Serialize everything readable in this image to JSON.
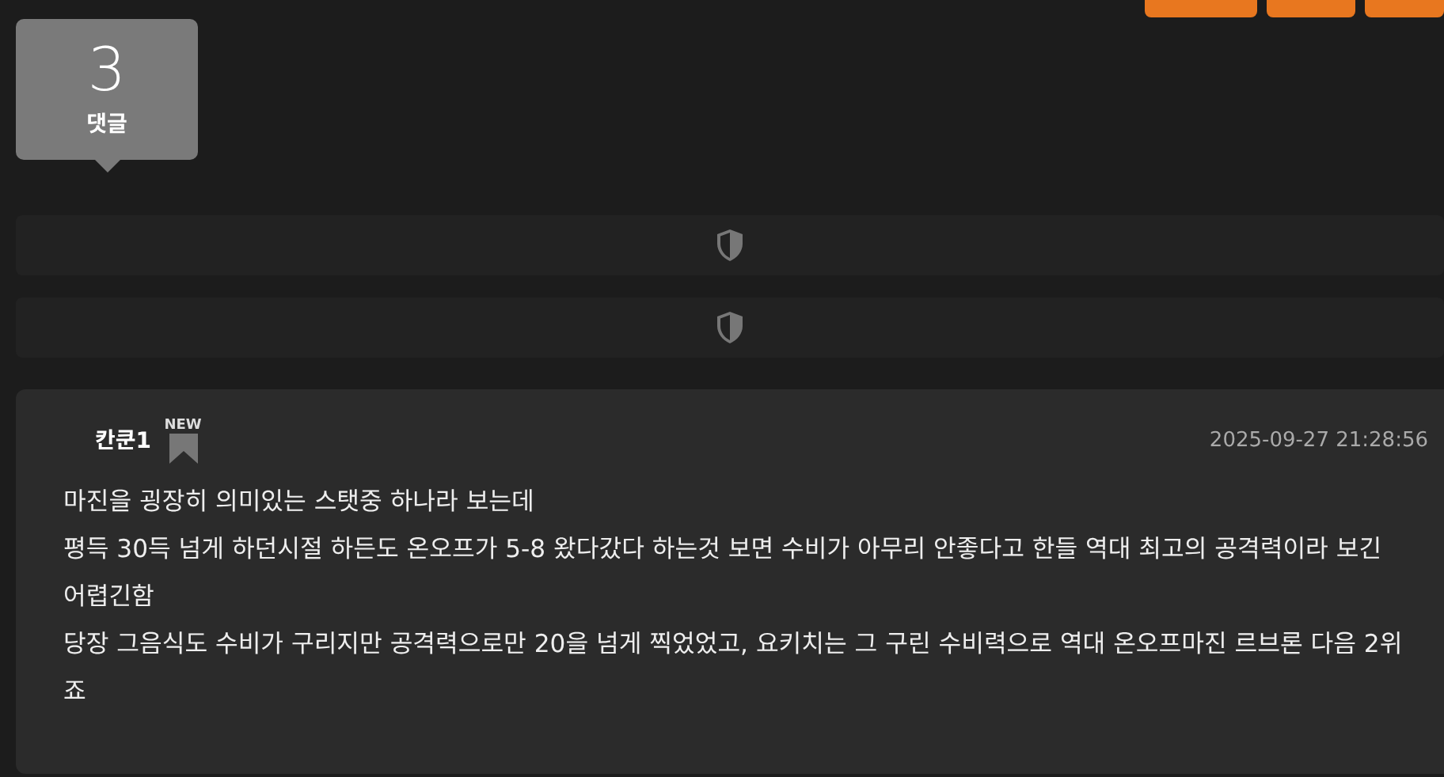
{
  "top_buttons": [
    {
      "kind": "button"
    },
    {
      "kind": "button"
    },
    {
      "kind": "button"
    }
  ],
  "comment_count": {
    "number": "3",
    "label": "댓글"
  },
  "blocked_comments": [
    {
      "kind": "blocked"
    },
    {
      "kind": "blocked"
    }
  ],
  "comment": {
    "author": "칸쿤1",
    "badge": "NEW",
    "timestamp": "2025-09-27 21:28:56",
    "paragraphs": [
      "마진을 굉장히 의미있는 스탯중 하나라 보는데",
      "평득 30득 넘게 하던시절 하든도 온오프가 5-8 왔다갔다 하는것 보면 수비가 아무리 안좋다고 한들 역대 최고의 공격력이라 보긴 어렵긴함",
      "당장 그음식도 수비가 구리지만 공격력으로만 20을 넘게 찍었었고,  요키치는 그 구린 수비력으로 역대 온오프마진 르브론 다음 2위죠"
    ]
  }
}
